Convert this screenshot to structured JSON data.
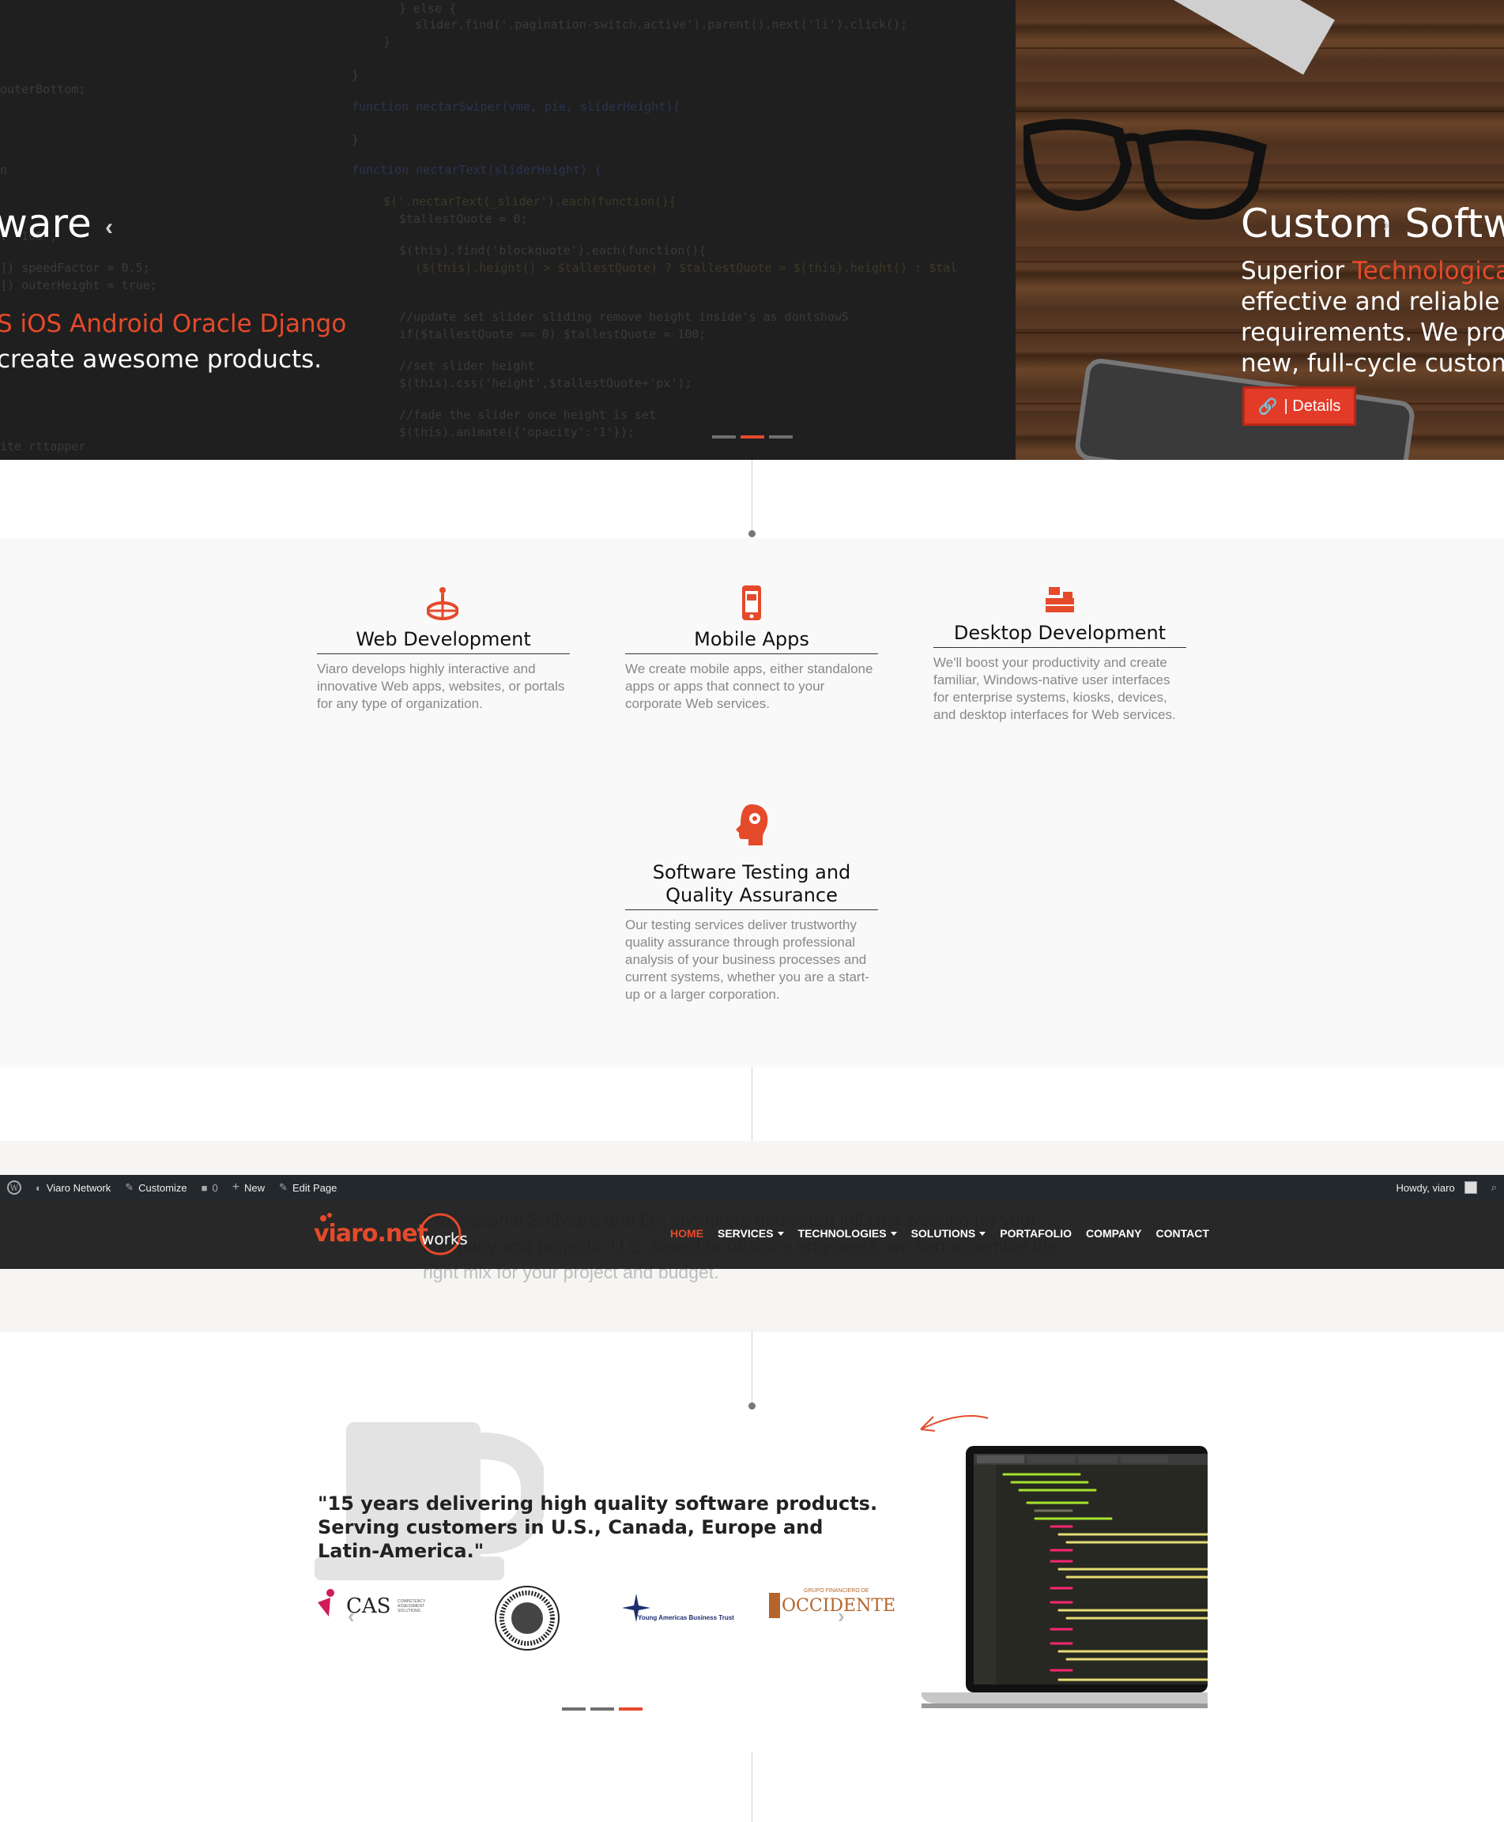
{
  "hero": {
    "slide_left": {
      "title_fragment": "ware",
      "tech_line": "S iOS Android Oracle Django",
      "tag_line": "create awesome products."
    },
    "slide_right": {
      "title": "Custom Softwa",
      "line1_prefix": "Superior ",
      "line1_highlight": "Technologica",
      "line2": "effective and reliable p",
      "line3": "requirements. We prov",
      "line4": "new, full-cycle customi",
      "button_label": "| Details"
    },
    "dots": [
      false,
      true,
      false
    ],
    "icons": {
      "prev": "chevron-left-icon",
      "next": "chevron-right-icon",
      "details": "link-icon"
    }
  },
  "services": [
    {
      "title": "Web Development",
      "description": "Viaro develops highly interactive and innovative Web apps, websites, or portals for any type of organization.",
      "icon": "globe-person-icon"
    },
    {
      "title": "Mobile Apps",
      "description": "We create mobile apps, either standalone apps or apps that connect to your corporate Web services.",
      "icon": "smartphone-icon"
    },
    {
      "title": "Desktop Development",
      "description": "We'll boost your productivity and create familiar, Windows-native user interfaces for enterprise systems, kiosks, devices, and desktop interfaces for Web services.",
      "icon": "desktop-workstation-icon"
    },
    {
      "title": "Software Testing and Quality Assurance",
      "description": "Our testing services deliver trustworthy quality assurance through professional analysis of your business processes and current systems, whether you are a start-up or a larger corporation.",
      "icon": "head-gear-icon"
    }
  ],
  "strip": {
    "text": "Professional Software and QA engineers dedicated full time working for your company and projects. U.S. based or offshore engineers, we can assemble the right mix for your project and budget."
  },
  "admin_bar": {
    "items": [
      "Viaro Network",
      "Customize",
      "0",
      "New",
      "Edit Page"
    ],
    "howdy": "Howdy, viaro"
  },
  "nav": {
    "logo_text": "viaro.net",
    "logo_suffix": "works",
    "items": [
      {
        "label": "HOME",
        "current": true,
        "dropdown": false
      },
      {
        "label": "SERVICES",
        "current": false,
        "dropdown": true
      },
      {
        "label": "TECHNOLOGIES",
        "current": false,
        "dropdown": true
      },
      {
        "label": "SOLUTIONS",
        "current": false,
        "dropdown": true
      },
      {
        "label": "PORTAFOLIO",
        "current": false,
        "dropdown": false
      },
      {
        "label": "COMPANY",
        "current": false,
        "dropdown": false
      },
      {
        "label": "CONTACT",
        "current": false,
        "dropdown": false
      }
    ]
  },
  "testimonial": {
    "quote": "\"15 years delivering high quality software products. Serving customers in U.S., Canada, Europe and Latin-America.\"",
    "clients": [
      {
        "name": "CAS",
        "tagline": "COMPETENCY ASSESSMENT SOLUTIONS"
      },
      {
        "name": "university-seal",
        "tagline": ""
      },
      {
        "name": "Young Americas Business Trust",
        "tagline": ""
      },
      {
        "name": "OCCIDENTE",
        "tagline": "GRUPO FINANCIERO DE"
      }
    ],
    "dots": [
      false,
      false,
      true
    ]
  },
  "colors": {
    "accent": "#e54a2b",
    "dark": "#1f1f1f",
    "admin": "#23282d"
  }
}
